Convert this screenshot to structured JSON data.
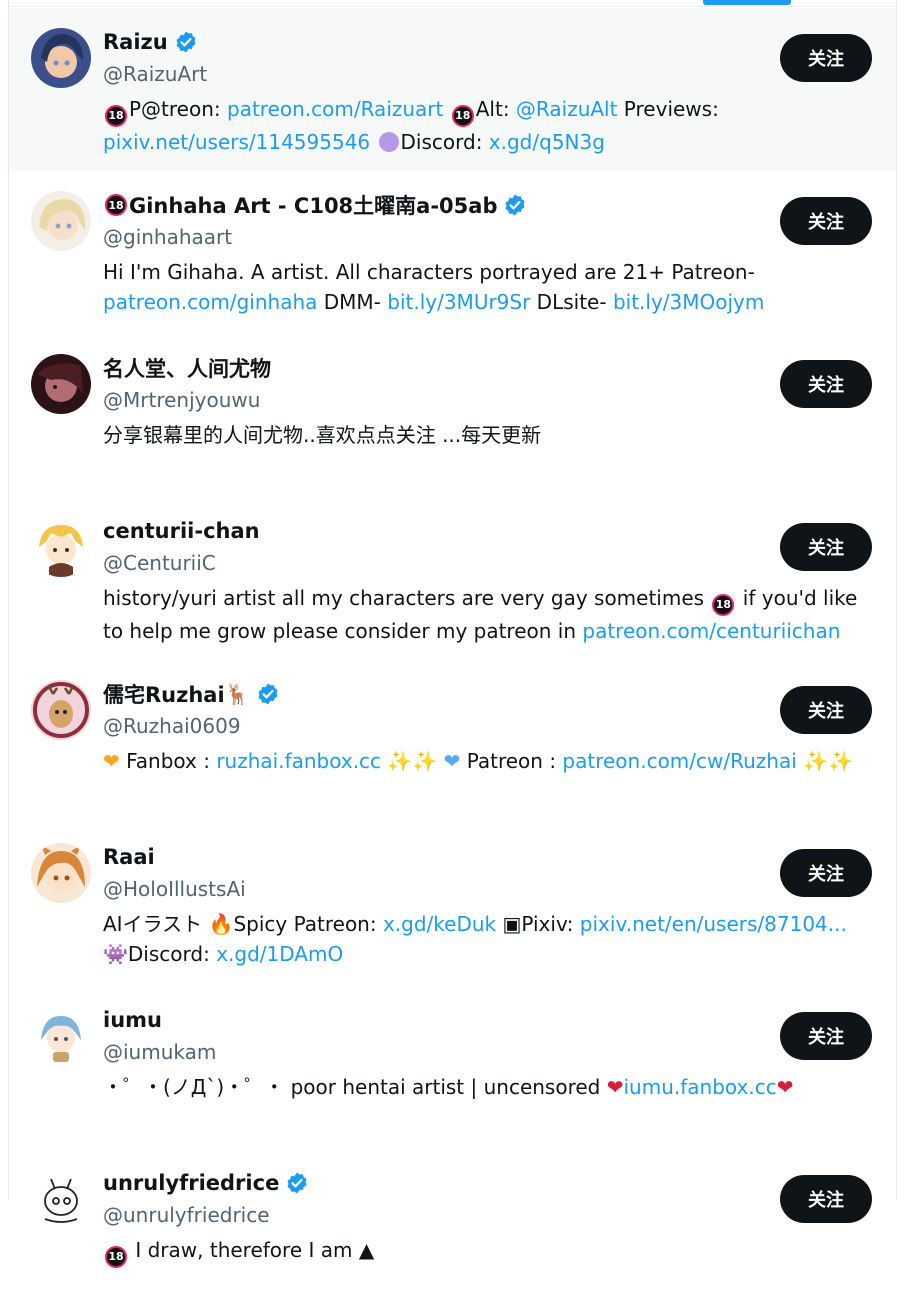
{
  "users": [
    {
      "name": "Raizu",
      "handle": "@RaizuArt",
      "verified": true,
      "follow_label": "关注",
      "avatar_icon": "avatar-blue-hair-girl",
      "bio": [
        {
          "t": "e18"
        },
        {
          "t": "text",
          "v": "P@treon: "
        },
        {
          "t": "link",
          "v": "patreon.com/Raizuart"
        },
        {
          "t": "text",
          "v": " "
        },
        {
          "t": "e18"
        },
        {
          "t": "text",
          "v": "Alt: "
        },
        {
          "t": "link",
          "v": "@RaizuAlt"
        },
        {
          "t": "text",
          "v": " Previews: "
        },
        {
          "t": "link",
          "v": "pixiv.net/users/114595546"
        },
        {
          "t": "text",
          "v": " "
        },
        {
          "t": "purple"
        },
        {
          "t": "text",
          "v": "Discord: "
        },
        {
          "t": "link",
          "v": "x.gd/q5N3g"
        }
      ]
    },
    {
      "name_prefix": "e18",
      "name": "Ginhaha Art - C108土曜南a-05ab",
      "handle": "@ginhahaart",
      "verified": true,
      "follow_label": "关注",
      "avatar_icon": "avatar-blonde-girl",
      "bio": [
        {
          "t": "text",
          "v": "Hi I'm Gihaha. A artist. All characters portrayed are 21+ Patreon- "
        },
        {
          "t": "link",
          "v": "patreon.com/ginhaha"
        },
        {
          "t": "text",
          "v": " DMM- "
        },
        {
          "t": "link",
          "v": "bit.ly/3MUr9Sr"
        },
        {
          "t": "text",
          "v": " DLsite- "
        },
        {
          "t": "link",
          "v": "bit.ly/3MOojym"
        }
      ]
    },
    {
      "name": "名人堂、人间尤物",
      "handle": "@Mrtrenjyouwu",
      "verified": false,
      "follow_label": "关注",
      "avatar_icon": "avatar-dark-photo",
      "bio": [
        {
          "t": "text",
          "v": "分享银幕里的人间尤物..喜欢点点关注 ...每天更新"
        }
      ]
    },
    {
      "name": "centurii-chan",
      "handle": "@CenturiiC",
      "verified": false,
      "follow_label": "关注",
      "avatar_icon": "avatar-blonde-chibi",
      "bio": [
        {
          "t": "text",
          "v": "history/yuri artist all my characters are very gay sometimes "
        },
        {
          "t": "e18"
        },
        {
          "t": "text",
          "v": " if you'd like to help me grow please consider my patreon in "
        },
        {
          "t": "link",
          "v": "patreon.com/centuriichan"
        }
      ]
    },
    {
      "name": "儒宅Ruzhai",
      "name_suffix": "🦌",
      "handle": "@Ruzhai0609",
      "verified": true,
      "follow_label": "关注",
      "avatar_icon": "avatar-deer-pink",
      "bio": [
        {
          "t": "heart-orange"
        },
        {
          "t": "text",
          "v": " Fanbox : "
        },
        {
          "t": "link",
          "v": "ruzhai.fanbox.cc"
        },
        {
          "t": "text",
          "v": " "
        },
        {
          "t": "sparkles"
        },
        {
          "t": "sparkles"
        },
        {
          "t": "text",
          "v": " "
        },
        {
          "t": "heart-blue"
        },
        {
          "t": "text",
          "v": " Patreon : "
        },
        {
          "t": "link",
          "v": "patreon.com/cw/Ruzhai"
        },
        {
          "t": "text",
          "v": " "
        },
        {
          "t": "sparkles"
        },
        {
          "t": "sparkles"
        }
      ]
    },
    {
      "name": "Raai",
      "handle": "@HoloIllustsAi",
      "verified": false,
      "follow_label": "关注",
      "avatar_icon": "avatar-orange-hair-girl",
      "bio": [
        {
          "t": "text",
          "v": "AIイラスト "
        },
        {
          "t": "fire"
        },
        {
          "t": "text",
          "v": "Spicy Patreon: "
        },
        {
          "t": "link",
          "v": "x.gd/keDuk"
        },
        {
          "t": "text",
          "v": " "
        },
        {
          "t": "picture"
        },
        {
          "t": "text",
          "v": "Pixiv: "
        },
        {
          "t": "link",
          "v": "pixiv.net/en/users/87104..."
        },
        {
          "t": "text",
          "v": " "
        },
        {
          "t": "invader"
        },
        {
          "t": "text",
          "v": "Discord: "
        },
        {
          "t": "link",
          "v": "x.gd/1DAmO"
        }
      ]
    },
    {
      "name": "iumu",
      "handle": "@iumukam",
      "verified": false,
      "follow_label": "关注",
      "avatar_icon": "avatar-blue-hair-chibi",
      "bio": [
        {
          "t": "text",
          "v": "・゜・(ノД`)・゜・ poor hentai artist | uncensored "
        },
        {
          "t": "heart-red"
        },
        {
          "t": "link",
          "v": "iumu.fanbox.cc"
        },
        {
          "t": "heart-red"
        }
      ]
    },
    {
      "name": "unrulyfriedrice",
      "handle": "@unrulyfriedrice",
      "verified": true,
      "follow_label": "关注",
      "avatar_icon": "avatar-sketch-doodle",
      "bio": [
        {
          "t": "e18"
        },
        {
          "t": "text",
          "v": " I draw, therefore I am "
        },
        {
          "t": "riceball"
        }
      ]
    }
  ],
  "icons": {
    "e18_text": "18",
    "sparkles": "✨",
    "heart_orange": "❤",
    "heart_blue": "❤",
    "heart_red": "❤",
    "fire": "🔥",
    "picture": "▣",
    "invader": "👾",
    "riceball": "▲"
  },
  "colors": {
    "accent": "#1d9bf0",
    "button": "#0f1419",
    "secondary_text": "#536471",
    "highlight_row": "#f7f9f9"
  }
}
